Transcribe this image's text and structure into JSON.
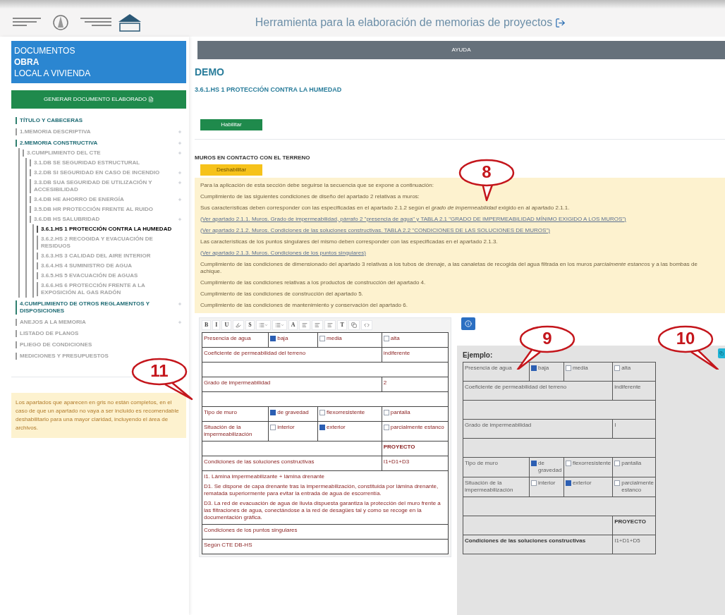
{
  "header": {
    "title": "Herramienta para la elaboración de memorias de proyectos"
  },
  "sidebar": {
    "project": {
      "heading": "DOCUMENTOS",
      "name": "OBRA",
      "type": "LOCAL A VIVIENDA"
    },
    "generate_button": "GENERAR DOCUMENTO ELABORADO",
    "items": [
      {
        "label": "TÍTULO Y CABECERAS",
        "complete": true,
        "selected": false,
        "expandable": false
      },
      {
        "label": "1.MEMORIA DESCRIPTIVA",
        "complete": false,
        "selected": false,
        "expandable": true
      },
      {
        "label": "2.MEMORIA CONSTRUCTIVA",
        "complete": true,
        "selected": false,
        "expandable": true,
        "expanded": true,
        "children": [
          {
            "label": "3.CUMPLIMIENTO DEL CTE",
            "complete": false,
            "selected": false,
            "expandable": true,
            "expanded": true,
            "children": [
              {
                "label": "3.1.DB SE SEGURIDAD ESTRUCTURAL",
                "complete": false,
                "selected": false,
                "expandable": false
              },
              {
                "label": "3.2.DB SI SEGURIDAD EN CASO DE INCENDIO",
                "complete": false,
                "selected": false,
                "expandable": true
              },
              {
                "label": "3.3.DB SUA SEGURIDAD DE UTILIZACIÓN Y ACCESIBILIDAD",
                "complete": false,
                "selected": false,
                "expandable": true
              },
              {
                "label": "3.4.DB HE AHORRO DE ENERGÍA",
                "complete": false,
                "selected": false,
                "expandable": true
              },
              {
                "label": "3.5.DB HR PROTECCIÓN FRENTE AL RUIDO",
                "complete": false,
                "selected": false,
                "expandable": false
              },
              {
                "label": "3.6.DB HS SALUBRIDAD",
                "complete": false,
                "selected": false,
                "expandable": true,
                "expanded": true,
                "children": [
                  {
                    "label": "3.6.1.HS 1 PROTECCIÓN CONTRA LA HUMEDAD",
                    "complete": false,
                    "selected": true,
                    "expandable": false
                  },
                  {
                    "label": "3.6.2.HS 2 RECOGIDA Y EVACUACIÓN DE RESIDUOS",
                    "complete": false,
                    "selected": false,
                    "expandable": false
                  },
                  {
                    "label": "3.6.3.HS 3 CALIDAD DEL AIRE INTERIOR",
                    "complete": false,
                    "selected": false,
                    "expandable": false
                  },
                  {
                    "label": "3.6.4.HS 4 SUMINISTRO DE AGUA",
                    "complete": false,
                    "selected": false,
                    "expandable": false
                  },
                  {
                    "label": "3.6.5.HS 5 EVACUACIÓN DE AGUAS",
                    "complete": false,
                    "selected": false,
                    "expandable": false
                  },
                  {
                    "label": "3.6.6.HS 6 PROTECCIÓN FRENTE A LA EXPOSICIÓN AL GAS RADÓN",
                    "complete": false,
                    "selected": false,
                    "expandable": false
                  }
                ]
              }
            ]
          }
        ]
      },
      {
        "label": "4.CUMPLIMIENTO DE OTROS REGLAMENTOS Y DISPOSICIONES",
        "complete": true,
        "selected": false,
        "expandable": true
      },
      {
        "label": "ANEJOS A LA MEMORIA",
        "complete": false,
        "selected": false,
        "expandable": true
      },
      {
        "label": "LISTADO DE PLANOS",
        "complete": false,
        "selected": false,
        "expandable": false
      },
      {
        "label": "PLIEGO DE CONDICIONES",
        "complete": false,
        "selected": false,
        "expandable": false
      },
      {
        "label": "MEDICIONES Y PRESUPUESTOS",
        "complete": false,
        "selected": false,
        "expandable": false
      }
    ],
    "note": "Los apartados que aparecen en gris no están completos, en el caso de que un apartado no vaya a ser incluido es recomendable deshabilitarlo para una mayor claridad, incluyendo el área de archivos."
  },
  "main": {
    "help_button": "AYUDA",
    "project_title": "DEMO",
    "section_title": "3.6.1.HS 1 PROTECCIÓN CONTRA LA HUMEDAD",
    "enable_button": "Habilitar",
    "subsection": {
      "title": "MUROS EN CONTACTO CON EL TERRENO",
      "disable_button": "Deshabilitar",
      "lines": [
        {
          "kind": "text",
          "text": "Para la aplicación de esta sección debe seguirse la secuencia que se expone a continuación:"
        },
        {
          "kind": "text",
          "text": "Cumplimiento de las siguientes condiciones de diseño del apartado 2 relativas a muros:"
        },
        {
          "kind": "text",
          "text": "Sus características deben corresponder con las especificadas en el apartado 2.1.2 según el *grado de impermeabilidad* exigido en al apartado 2.1.1."
        },
        {
          "kind": "link",
          "text": "(Ver apartado 2.1.1. Muros. Grado de impermeabilidad, párrafo 2 \"presencia de agua\" y TABLA 2.1 \"GRADO DE IMPERMEABILIDAD MÍNIMO EXIGIDO A LOS MUROS\")"
        },
        {
          "kind": "link",
          "text": "(Ver apartado 2.1.2. Muros. Condiciones de las soluciones constructivas. TABLA 2.2 \"CONDICIONES DE LAS SOLUCIONES DE MUROS\")"
        },
        {
          "kind": "text",
          "text": "Las características de los puntos singulares del mismo deben corresponder con las especificadas en el apartado 2.1.3."
        },
        {
          "kind": "link",
          "text": "(Ver apartado 2.1.3. Muros. Condiciones de los puntos singulares)"
        },
        {
          "kind": "text",
          "text": "Cumplimiento de las condiciones de dimensionado del apartado 3 relativas a los tubos de drenaje, a las canaletas de recogida del agua filtrada en los muros *parcialmente estancos* y a las bombas de achique."
        },
        {
          "kind": "text",
          "text": "Cumplimiento de las condiciones relativas a los productos de construcción del apartado 4."
        },
        {
          "kind": "text",
          "text": "Cumplimiento de las condiciones de construcción del apartado 5."
        },
        {
          "kind": "text",
          "text": "Cumplimiento de las condiciones de mantenimiento y conservación del apartado 6."
        }
      ]
    }
  },
  "editor": {
    "toolbar": [
      {
        "kind": "letter",
        "label": "B"
      },
      {
        "kind": "letter",
        "label": "I"
      },
      {
        "kind": "letter",
        "label": "U"
      },
      {
        "kind": "marker"
      },
      {
        "kind": "letter",
        "label": "S"
      },
      {
        "kind": "list"
      },
      {
        "kind": "list"
      },
      {
        "kind": "letter",
        "label": "A"
      },
      {
        "kind": "align"
      },
      {
        "kind": "align"
      },
      {
        "kind": "align"
      },
      {
        "kind": "letter",
        "label": "T"
      },
      {
        "kind": "copy"
      },
      {
        "kind": "code"
      }
    ],
    "rows": [
      {
        "cells": [
          {
            "kind": "text",
            "text": "Presencia de agua"
          },
          {
            "kind": "check",
            "text": "baja",
            "checked": true
          },
          {
            "kind": "check",
            "text": "media",
            "checked": false
          },
          {
            "kind": "check",
            "text": "alta",
            "checked": false
          }
        ]
      },
      {
        "cells": [
          {
            "kind": "text",
            "text": "Coeficiente de permeabilidad del terreno",
            "colspan": 3
          },
          {
            "kind": "text",
            "text": "indiferente"
          }
        ]
      },
      {
        "cells": [
          {
            "kind": "blank",
            "colspan": 4
          }
        ]
      },
      {
        "cells": [
          {
            "kind": "text",
            "text": "Grado de impermeabilidad",
            "colspan": 3
          },
          {
            "kind": "text",
            "text": "2"
          }
        ]
      },
      {
        "cells": [
          {
            "kind": "blank",
            "colspan": 4
          }
        ]
      },
      {
        "cells": [
          {
            "kind": "text",
            "text": "Tipo de muro"
          },
          {
            "kind": "check",
            "text": "de gravedad",
            "checked": true
          },
          {
            "kind": "check",
            "text": "flexorresistente",
            "checked": false
          },
          {
            "kind": "check",
            "text": "pantalla",
            "checked": false
          }
        ]
      },
      {
        "cells": [
          {
            "kind": "text",
            "text": "Situación de la impermeabilización"
          },
          {
            "kind": "check",
            "text": "interior",
            "checked": false
          },
          {
            "kind": "check",
            "text": "exterior",
            "checked": true
          },
          {
            "kind": "check",
            "text": "parcialmente estanco",
            "checked": false
          }
        ]
      },
      {
        "cells": [
          {
            "kind": "blank",
            "colspan": 3
          },
          {
            "kind": "heading",
            "text": "PROYECTO"
          }
        ]
      },
      {
        "cells": [
          {
            "kind": "text",
            "text": "Condiciones de las soluciones constructivas",
            "colspan": 3
          },
          {
            "kind": "text",
            "text": "I1+D1+D3"
          }
        ]
      },
      {
        "cells": [
          {
            "kind": "paragraphs",
            "colspan": 4,
            "lines": [
              "I1. Lámina impermeabilizante + lámina drenante",
              "D1. Se dispone de capa drenante tras la impermeabilización, constituida por lámina drenante, rematada superiormente para evitar la entrada de agua de escorrentía.",
              "D3. La red de evacuación de agua de lluvia dispuesta garantiza la protección del muro frente a las filtraciones de agua, conectándose a la red de desagües tal y como se recoge en la documentación gráfica."
            ]
          }
        ]
      },
      {
        "cells": [
          {
            "kind": "text",
            "text": "Condiciones de los puntos singulares",
            "colspan": 4
          }
        ]
      },
      {
        "cells": [
          {
            "kind": "text",
            "text": "Según CTE DB-HS",
            "colspan": 4
          }
        ]
      }
    ]
  },
  "example": {
    "title": "Ejemplo:",
    "rows": [
      {
        "cells": [
          {
            "kind": "text",
            "text": "Presencia de agua"
          },
          {
            "kind": "check",
            "text": "baja",
            "checked": true
          },
          {
            "kind": "check",
            "text": "media",
            "checked": false
          },
          {
            "kind": "check",
            "text": "alta",
            "checked": false
          }
        ]
      },
      {
        "cells": [
          {
            "kind": "text",
            "text": "Coeficiente de permeabilidad del terreno",
            "colspan": 3
          },
          {
            "kind": "text",
            "text": "indiferente"
          }
        ]
      },
      {
        "cells": [
          {
            "kind": "blank",
            "colspan": 4
          }
        ]
      },
      {
        "cells": [
          {
            "kind": "text",
            "text": "Grado de impermeabilidad",
            "colspan": 3
          },
          {
            "kind": "text",
            "text": "I"
          }
        ]
      },
      {
        "cells": [
          {
            "kind": "blank",
            "colspan": 4
          }
        ]
      },
      {
        "cells": [
          {
            "kind": "text",
            "text": "Tipo de muro"
          },
          {
            "kind": "check",
            "text": "de gravedad",
            "checked": true
          },
          {
            "kind": "check",
            "text": "flexorresistente",
            "checked": false
          },
          {
            "kind": "check",
            "text": "pantalla",
            "checked": false
          }
        ]
      },
      {
        "cells": [
          {
            "kind": "text",
            "text": "Situación de la impermeabilización"
          },
          {
            "kind": "check",
            "text": "interior",
            "checked": false
          },
          {
            "kind": "check",
            "text": "exterior",
            "checked": true
          },
          {
            "kind": "check",
            "text": "parcialmente estanco",
            "checked": false
          }
        ]
      },
      {
        "cells": [
          {
            "kind": "blank",
            "colspan": 4
          }
        ]
      },
      {
        "cells": [
          {
            "kind": "blank",
            "colspan": 3
          },
          {
            "kind": "heading",
            "text": "PROYECTO"
          }
        ]
      },
      {
        "cells": [
          {
            "kind": "heading",
            "text": "Condiciones de las soluciones constructivas",
            "colspan": 3
          },
          {
            "kind": "text",
            "text": "I1+D1+D5"
          }
        ]
      }
    ]
  },
  "callouts": [
    {
      "label": "8"
    },
    {
      "label": "9"
    },
    {
      "label": "10"
    },
    {
      "label": "11"
    }
  ]
}
